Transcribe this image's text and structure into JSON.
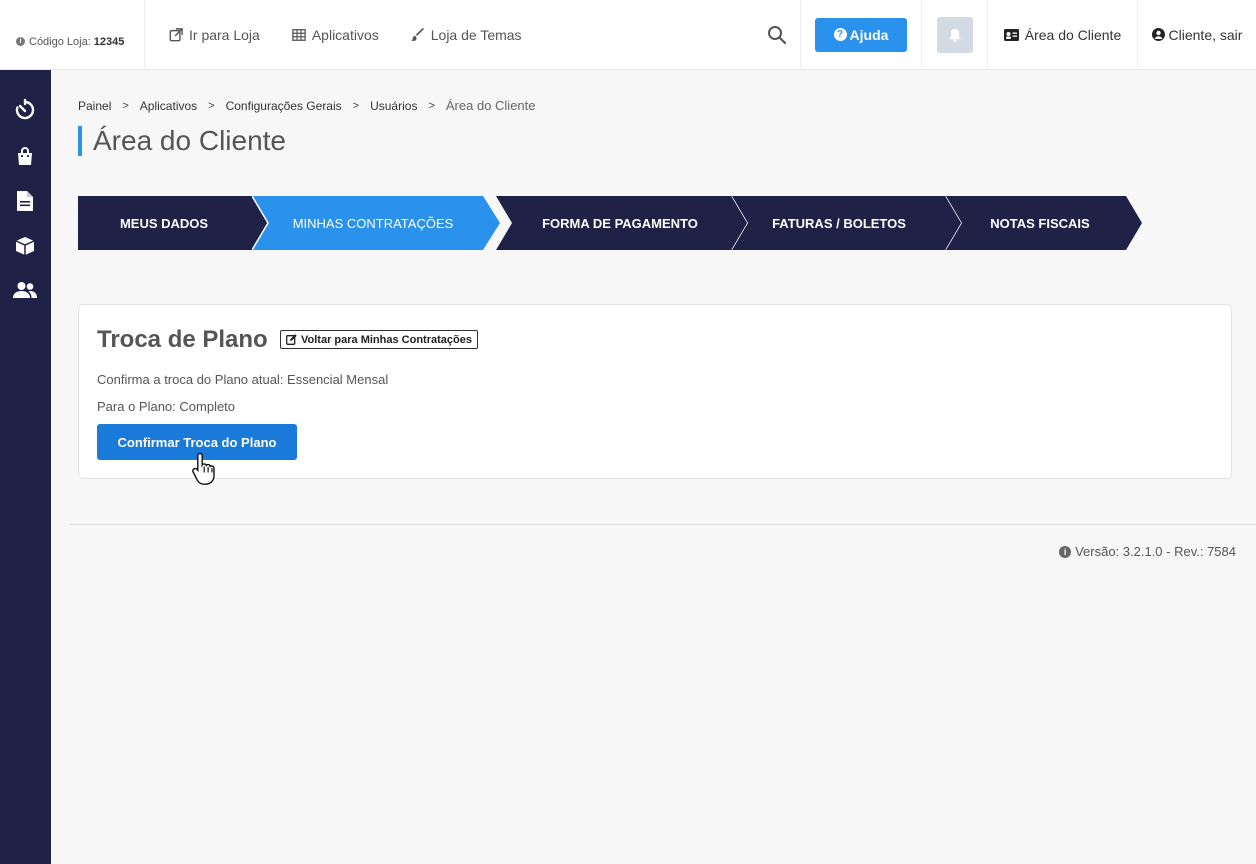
{
  "topbar": {
    "store_code_label": "Código Loja:",
    "store_code_value": "12345",
    "nav": [
      {
        "label": "Ir para Loja",
        "icon": "external-link-icon"
      },
      {
        "label": "Aplicativos",
        "icon": "grid-icon"
      },
      {
        "label": "Loja de Temas",
        "icon": "brush-icon"
      }
    ],
    "help_label": "Ajuda",
    "client_area_label": "Área do Cliente",
    "logout_label": "Cliente, sair"
  },
  "sidebar": {
    "items": [
      {
        "icon": "dashboard-timer-icon"
      },
      {
        "icon": "shopping-bag-icon"
      },
      {
        "icon": "document-icon"
      },
      {
        "icon": "box-icon"
      },
      {
        "icon": "users-icon"
      }
    ]
  },
  "breadcrumb": [
    "Painel",
    "Aplicativos",
    "Configurações Gerais",
    "Usuários",
    "Área do Cliente"
  ],
  "page_title": "Área do Cliente",
  "steps": [
    {
      "label": "MEUS DADOS",
      "active": false
    },
    {
      "label": "MINHAS CONTRATAÇÕES",
      "active": true
    },
    {
      "label": "FORMA DE PAGAMENTO",
      "active": false
    },
    {
      "label": "FATURAS / BOLETOS",
      "active": false
    },
    {
      "label": "NOTAS FISCAIS",
      "active": false
    }
  ],
  "card": {
    "title": "Troca de Plano",
    "back_link": "Voltar para Minhas Contratações",
    "line1": "Confirma a troca do Plano atual: Essencial Mensal",
    "line2": "Para o Plano: Completo",
    "confirm_button": "Confirmar Troca do Plano"
  },
  "footer": {
    "version": "Versão: 3.2.1.0 - Rev.: 7584"
  },
  "colors": {
    "sidebar": "#1f2146",
    "step_dark": "#1f2146",
    "step_active": "#2a91ec",
    "primary_button": "#1a7ad9"
  }
}
